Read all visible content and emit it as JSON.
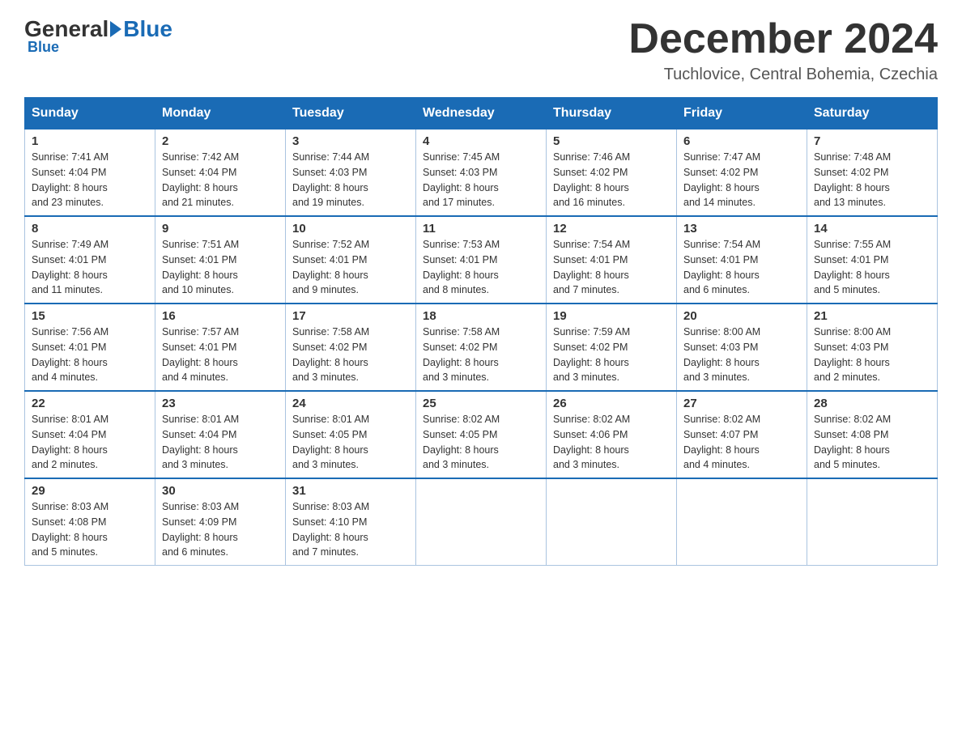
{
  "header": {
    "logo_general": "General",
    "logo_blue": "Blue",
    "month_title": "December 2024",
    "subtitle": "Tuchlovice, Central Bohemia, Czechia"
  },
  "weekdays": [
    "Sunday",
    "Monday",
    "Tuesday",
    "Wednesday",
    "Thursday",
    "Friday",
    "Saturday"
  ],
  "weeks": [
    [
      {
        "day": "1",
        "sunrise": "7:41 AM",
        "sunset": "4:04 PM",
        "daylight": "8 hours and 23 minutes."
      },
      {
        "day": "2",
        "sunrise": "7:42 AM",
        "sunset": "4:04 PM",
        "daylight": "8 hours and 21 minutes."
      },
      {
        "day": "3",
        "sunrise": "7:44 AM",
        "sunset": "4:03 PM",
        "daylight": "8 hours and 19 minutes."
      },
      {
        "day": "4",
        "sunrise": "7:45 AM",
        "sunset": "4:03 PM",
        "daylight": "8 hours and 17 minutes."
      },
      {
        "day": "5",
        "sunrise": "7:46 AM",
        "sunset": "4:02 PM",
        "daylight": "8 hours and 16 minutes."
      },
      {
        "day": "6",
        "sunrise": "7:47 AM",
        "sunset": "4:02 PM",
        "daylight": "8 hours and 14 minutes."
      },
      {
        "day": "7",
        "sunrise": "7:48 AM",
        "sunset": "4:02 PM",
        "daylight": "8 hours and 13 minutes."
      }
    ],
    [
      {
        "day": "8",
        "sunrise": "7:49 AM",
        "sunset": "4:01 PM",
        "daylight": "8 hours and 11 minutes."
      },
      {
        "day": "9",
        "sunrise": "7:51 AM",
        "sunset": "4:01 PM",
        "daylight": "8 hours and 10 minutes."
      },
      {
        "day": "10",
        "sunrise": "7:52 AM",
        "sunset": "4:01 PM",
        "daylight": "8 hours and 9 minutes."
      },
      {
        "day": "11",
        "sunrise": "7:53 AM",
        "sunset": "4:01 PM",
        "daylight": "8 hours and 8 minutes."
      },
      {
        "day": "12",
        "sunrise": "7:54 AM",
        "sunset": "4:01 PM",
        "daylight": "8 hours and 7 minutes."
      },
      {
        "day": "13",
        "sunrise": "7:54 AM",
        "sunset": "4:01 PM",
        "daylight": "8 hours and 6 minutes."
      },
      {
        "day": "14",
        "sunrise": "7:55 AM",
        "sunset": "4:01 PM",
        "daylight": "8 hours and 5 minutes."
      }
    ],
    [
      {
        "day": "15",
        "sunrise": "7:56 AM",
        "sunset": "4:01 PM",
        "daylight": "8 hours and 4 minutes."
      },
      {
        "day": "16",
        "sunrise": "7:57 AM",
        "sunset": "4:01 PM",
        "daylight": "8 hours and 4 minutes."
      },
      {
        "day": "17",
        "sunrise": "7:58 AM",
        "sunset": "4:02 PM",
        "daylight": "8 hours and 3 minutes."
      },
      {
        "day": "18",
        "sunrise": "7:58 AM",
        "sunset": "4:02 PM",
        "daylight": "8 hours and 3 minutes."
      },
      {
        "day": "19",
        "sunrise": "7:59 AM",
        "sunset": "4:02 PM",
        "daylight": "8 hours and 3 minutes."
      },
      {
        "day": "20",
        "sunrise": "8:00 AM",
        "sunset": "4:03 PM",
        "daylight": "8 hours and 3 minutes."
      },
      {
        "day": "21",
        "sunrise": "8:00 AM",
        "sunset": "4:03 PM",
        "daylight": "8 hours and 2 minutes."
      }
    ],
    [
      {
        "day": "22",
        "sunrise": "8:01 AM",
        "sunset": "4:04 PM",
        "daylight": "8 hours and 2 minutes."
      },
      {
        "day": "23",
        "sunrise": "8:01 AM",
        "sunset": "4:04 PM",
        "daylight": "8 hours and 3 minutes."
      },
      {
        "day": "24",
        "sunrise": "8:01 AM",
        "sunset": "4:05 PM",
        "daylight": "8 hours and 3 minutes."
      },
      {
        "day": "25",
        "sunrise": "8:02 AM",
        "sunset": "4:05 PM",
        "daylight": "8 hours and 3 minutes."
      },
      {
        "day": "26",
        "sunrise": "8:02 AM",
        "sunset": "4:06 PM",
        "daylight": "8 hours and 3 minutes."
      },
      {
        "day": "27",
        "sunrise": "8:02 AM",
        "sunset": "4:07 PM",
        "daylight": "8 hours and 4 minutes."
      },
      {
        "day": "28",
        "sunrise": "8:02 AM",
        "sunset": "4:08 PM",
        "daylight": "8 hours and 5 minutes."
      }
    ],
    [
      {
        "day": "29",
        "sunrise": "8:03 AM",
        "sunset": "4:08 PM",
        "daylight": "8 hours and 5 minutes."
      },
      {
        "day": "30",
        "sunrise": "8:03 AM",
        "sunset": "4:09 PM",
        "daylight": "8 hours and 6 minutes."
      },
      {
        "day": "31",
        "sunrise": "8:03 AM",
        "sunset": "4:10 PM",
        "daylight": "8 hours and 7 minutes."
      },
      null,
      null,
      null,
      null
    ]
  ]
}
